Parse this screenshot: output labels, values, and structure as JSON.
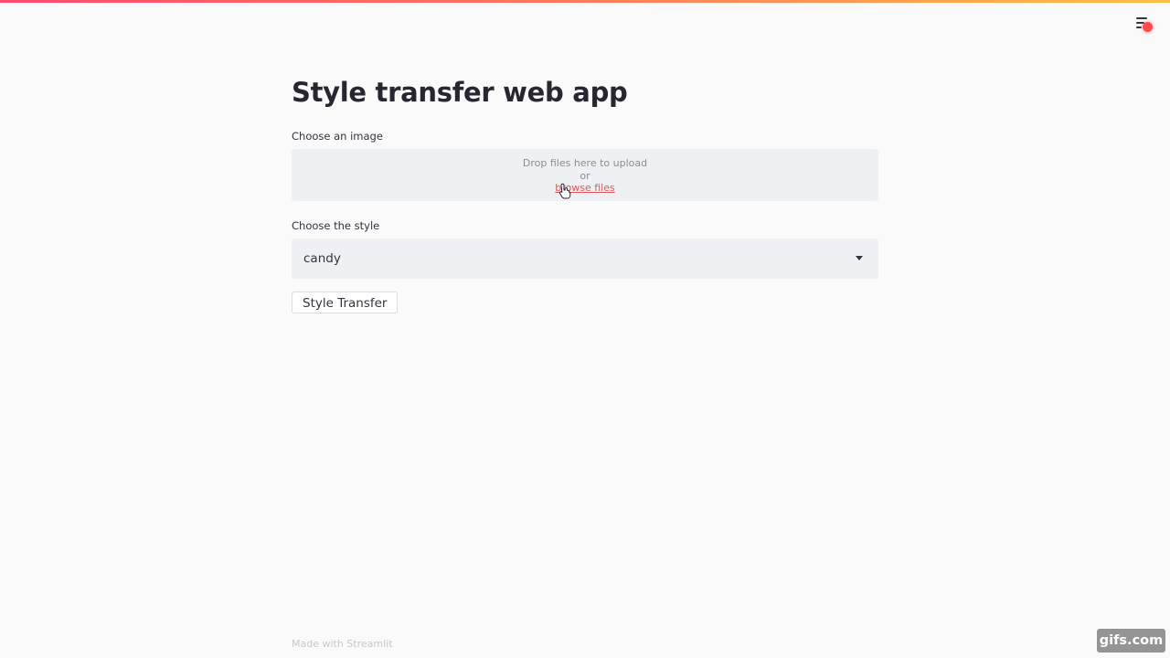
{
  "app": {
    "title": "Style transfer web app"
  },
  "uploader": {
    "label": "Choose an image",
    "drop_text": "Drop files here to upload",
    "or_text": "or",
    "browse_link": "browse files"
  },
  "style_select": {
    "label": "Choose the style",
    "selected": "candy"
  },
  "action": {
    "button_label": "Style Transfer"
  },
  "footer": {
    "text": "Made with Streamlit"
  },
  "watermark": {
    "text": "gifs.com"
  },
  "icons": {
    "menu": "hamburger-menu-icon",
    "caret": "caret-down-icon",
    "cursor": "hand-pointer-icon"
  },
  "colors": {
    "accent": "#ff4b4b",
    "link": "#e0575b",
    "widget_bg": "#eef0f3",
    "page_bg": "#fafafa",
    "decoration_gradient": [
      "#ff4b6e",
      "#ffbd45"
    ]
  }
}
